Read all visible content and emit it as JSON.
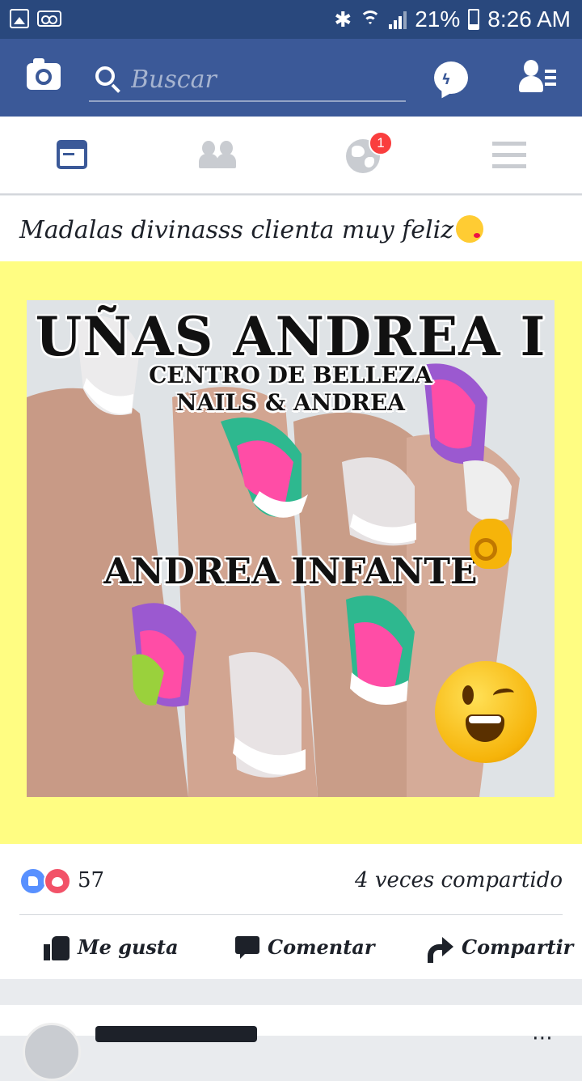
{
  "status_bar": {
    "battery": "21%",
    "time": "8:26 AM",
    "icons": [
      "image-icon",
      "voicemail-icon",
      "bluetooth-icon",
      "wifi-icon",
      "signal-icon",
      "battery-icon"
    ]
  },
  "app_bar": {
    "search_placeholder": "Buscar",
    "icons": [
      "camera-icon",
      "search-icon",
      "messenger-icon",
      "contacts-icon"
    ],
    "brand_color": "#3b5998"
  },
  "tabs": [
    {
      "name": "news-feed",
      "icon": "newsfeed-icon",
      "active": true
    },
    {
      "name": "friends",
      "icon": "friends-icon",
      "active": false
    },
    {
      "name": "notifications",
      "icon": "globe-icon",
      "badge": "1",
      "active": false
    },
    {
      "name": "menu",
      "icon": "hamburger-icon",
      "active": false
    }
  ],
  "post": {
    "text": "Madalas divinasss clienta muy feliz",
    "image": {
      "line1": "UÑAS ANDREA I",
      "line2": "CENTRO DE BELLEZA",
      "line3": "NAILS & ANDREA",
      "line4": "ANDREA INFANTE",
      "background": "#fffd82"
    },
    "reactions_count": "57",
    "shares": "4 veces compartido",
    "actions": {
      "like": "Me gusta",
      "comment": "Comentar",
      "share": "Compartir"
    }
  }
}
